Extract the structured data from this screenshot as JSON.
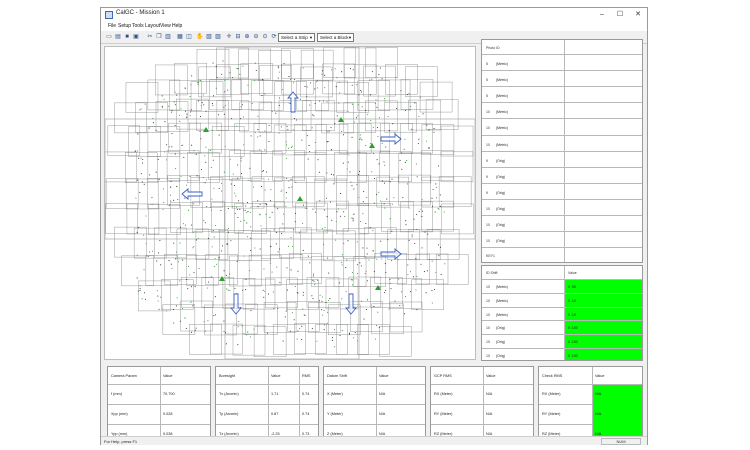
{
  "window": {
    "title": "CalGC - Mission 1",
    "minimize": "–",
    "maximize": "☐",
    "close": "✕"
  },
  "menu": [
    "File",
    "Setup",
    "Tools",
    "Layout",
    "View",
    "Help"
  ],
  "toolbar": {
    "strip_select": "Select a Strip",
    "block_select": "Select a Block"
  },
  "side_top": {
    "header": "Photo ID",
    "rows": [
      {
        "id": "5",
        "type": "(Metric)"
      },
      {
        "id": "5",
        "type": "(Metric)"
      },
      {
        "id": "5",
        "type": "(Metric)"
      },
      {
        "id": "10",
        "type": "(Metric)"
      },
      {
        "id": "10",
        "type": "(Metric)"
      },
      {
        "id": "10",
        "type": "(Metric)"
      },
      {
        "id": "9",
        "type": "(Orig)"
      },
      {
        "id": "9",
        "type": "(Orig)"
      },
      {
        "id": "9",
        "type": "(Orig)"
      },
      {
        "id": "10",
        "type": "(Orig)"
      },
      {
        "id": "10",
        "type": "(Orig)"
      },
      {
        "id": "10",
        "type": "(Orig)"
      }
    ],
    "footer": "KEY1"
  },
  "side_bottom": {
    "header1": "ID  Shift",
    "header2": "Value",
    "rows": [
      {
        "id": "10",
        "type": "(Metric)",
        "value": "0 .05"
      },
      {
        "id": "10",
        "type": "(Metric)",
        "value": "0 .10"
      },
      {
        "id": "10",
        "type": "(Metric)",
        "value": "0 .10"
      },
      {
        "id": "10",
        "type": "(Orig)",
        "value": "0 .100"
      },
      {
        "id": "10",
        "type": "(Orig)",
        "value": "0 .100"
      },
      {
        "id": "10",
        "type": "(Orig)",
        "value": "0 .100"
      }
    ]
  },
  "tables": [
    {
      "h1": "Camera Param",
      "h2": "Value",
      "h3": "",
      "rows": [
        [
          "f      (mm)",
          "70.700",
          ""
        ],
        [
          "Xpp    (mm)",
          "0.028",
          ""
        ],
        [
          "Ypp    (mm)",
          "0.038",
          ""
        ]
      ]
    },
    {
      "h1": "Boresight",
      "h2": "Value",
      "h3": "RMS",
      "rows": [
        [
          "Tx (Arcmin)",
          "1.71",
          "0.74"
        ],
        [
          "Ty (Arcmin)",
          "0.87",
          "0.74"
        ],
        [
          "Tz (Arcmin)",
          "-2.25",
          "0.73"
        ]
      ]
    },
    {
      "h1": "Datum Shift",
      "h2": "Value",
      "h3": "",
      "rows": [
        [
          "X  (Meter)",
          "N/A",
          ""
        ],
        [
          "Y  (Meter)",
          "N/A",
          ""
        ],
        [
          "Z  (Meter)",
          "N/A",
          ""
        ]
      ]
    },
    {
      "h1": "GCP RMS",
      "h2": "Value",
      "h3": "",
      "rows": [
        [
          "RX  (Meter)",
          "N/A",
          ""
        ],
        [
          "RY  (Meter)",
          "N/A",
          ""
        ],
        [
          "RZ  (Meter)",
          "N/A",
          ""
        ]
      ]
    },
    {
      "h1": "Check RMS",
      "h2": "Value",
      "h3": "",
      "rows": [
        [
          "RX  (Meter)",
          "N/A",
          ""
        ],
        [
          "RY  (Meter)",
          "N/A",
          ""
        ],
        [
          "RZ  (Meter)",
          "N/A",
          ""
        ]
      ]
    }
  ],
  "status": {
    "help": "For Help, press F1",
    "num": "NUM"
  },
  "colors": {
    "accent_green": "#00ff00",
    "grid": "#6b6b6b",
    "arrow": "#3a5fc8",
    "point_green": "#2f9d2f"
  }
}
